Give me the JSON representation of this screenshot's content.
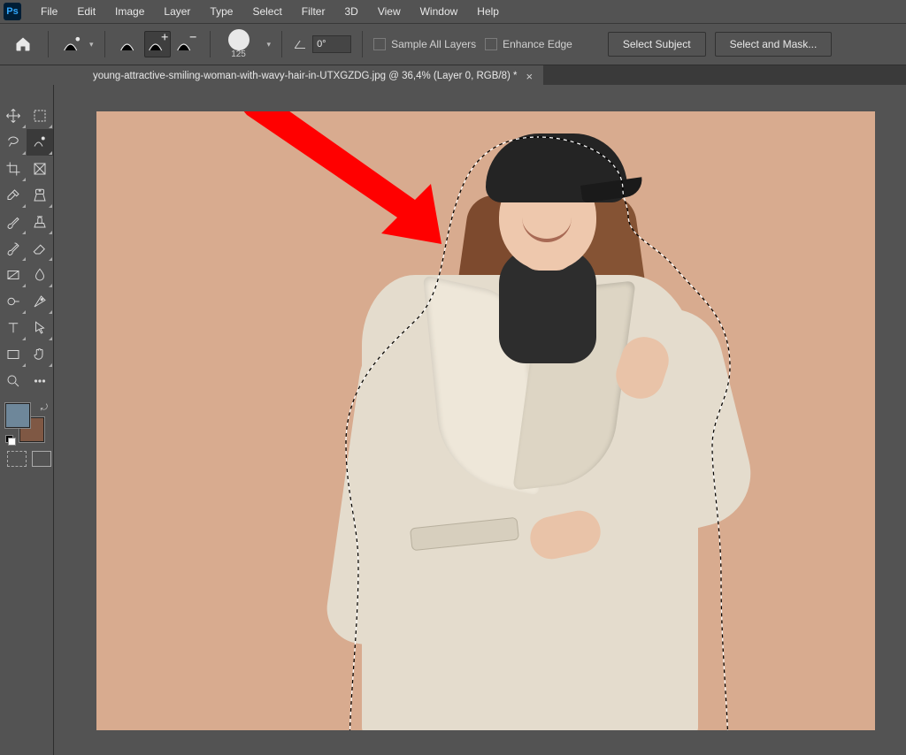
{
  "menu": {
    "items": [
      "File",
      "Edit",
      "Image",
      "Layer",
      "Type",
      "Select",
      "Filter",
      "3D",
      "View",
      "Window",
      "Help"
    ]
  },
  "options": {
    "brush_size": "125",
    "angle_value": "0°",
    "sample_all_layers": "Sample All Layers",
    "enhance_edge": "Enhance Edge",
    "select_subject": "Select Subject",
    "select_and_mask": "Select and Mask..."
  },
  "document": {
    "tab_title": "young-attractive-smiling-woman-with-wavy-hair-in-UTXGZDG.jpg @ 36,4% (Layer 0, RGB/8) *"
  },
  "swatches": {
    "foreground": "#6e879a",
    "background": "#7f5844"
  },
  "toolbox_header": ""
}
